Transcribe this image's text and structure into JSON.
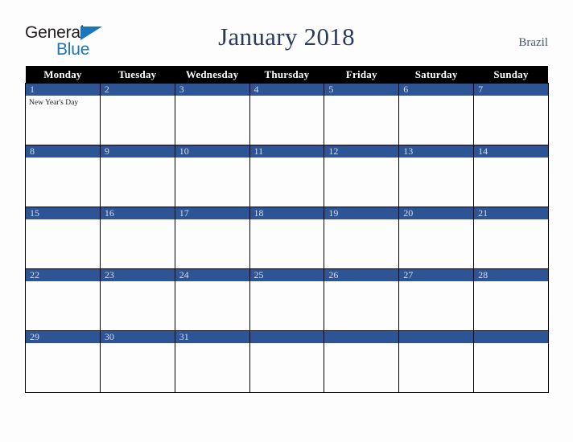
{
  "brand": {
    "name_part1": "General",
    "name_part2": "Blue",
    "triangle_icon": "blue-triangle-icon",
    "color_dark": "#231f20",
    "color_blue": "#1b75bc"
  },
  "header": {
    "title": "January 2018",
    "country": "Brazil",
    "title_color": "#2b3a5c",
    "country_color": "#4a5878"
  },
  "calendar": {
    "month": "January",
    "year": "2018",
    "accent_color": "#2d5596",
    "header_bg": "#000000",
    "header_text_color": "#ffffff",
    "date_text_color": "#d6dbe8",
    "weekday_headers": [
      "Monday",
      "Tuesday",
      "Wednesday",
      "Thursday",
      "Friday",
      "Saturday",
      "Sunday"
    ],
    "weeks": [
      [
        {
          "date": "1",
          "events": [
            "New Year's Day"
          ]
        },
        {
          "date": "2",
          "events": []
        },
        {
          "date": "3",
          "events": []
        },
        {
          "date": "4",
          "events": []
        },
        {
          "date": "5",
          "events": []
        },
        {
          "date": "6",
          "events": []
        },
        {
          "date": "7",
          "events": []
        }
      ],
      [
        {
          "date": "8",
          "events": []
        },
        {
          "date": "9",
          "events": []
        },
        {
          "date": "10",
          "events": []
        },
        {
          "date": "11",
          "events": []
        },
        {
          "date": "12",
          "events": []
        },
        {
          "date": "13",
          "events": []
        },
        {
          "date": "14",
          "events": []
        }
      ],
      [
        {
          "date": "15",
          "events": []
        },
        {
          "date": "16",
          "events": []
        },
        {
          "date": "17",
          "events": []
        },
        {
          "date": "18",
          "events": []
        },
        {
          "date": "19",
          "events": []
        },
        {
          "date": "20",
          "events": []
        },
        {
          "date": "21",
          "events": []
        }
      ],
      [
        {
          "date": "22",
          "events": []
        },
        {
          "date": "23",
          "events": []
        },
        {
          "date": "24",
          "events": []
        },
        {
          "date": "25",
          "events": []
        },
        {
          "date": "26",
          "events": []
        },
        {
          "date": "27",
          "events": []
        },
        {
          "date": "28",
          "events": []
        }
      ],
      [
        {
          "date": "29",
          "events": []
        },
        {
          "date": "30",
          "events": []
        },
        {
          "date": "31",
          "events": []
        },
        {
          "date": "",
          "events": []
        },
        {
          "date": "",
          "events": []
        },
        {
          "date": "",
          "events": []
        },
        {
          "date": "",
          "events": []
        }
      ]
    ]
  }
}
